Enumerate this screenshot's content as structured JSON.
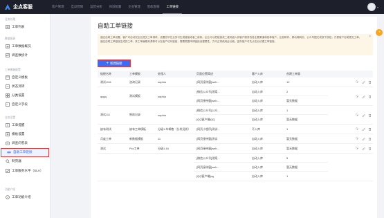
{
  "app": {
    "name": "企点客服"
  },
  "nav": [
    "客户管理",
    "互动营销",
    "运营分析",
    "体验配置",
    "企业管理",
    "智能客服",
    "工单链接"
  ],
  "sidebar": {
    "groups": [
      {
        "label": "业务处理",
        "items": [
          {
            "label": "工单列表",
            "icon": "list-icon"
          }
        ]
      },
      {
        "label": "数据报表",
        "items": [
          {
            "label": "工单数据概况",
            "icon": "chart-icon"
          },
          {
            "label": "调查数统计",
            "icon": "stats-icon"
          }
        ]
      },
      {
        "label": "工单模板配置",
        "items": [
          {
            "label": "自定义模板",
            "icon": "template-icon"
          },
          {
            "label": "状态流转",
            "icon": "flow-icon"
          },
          {
            "label": "分类设置",
            "icon": "category-icon"
          },
          {
            "label": "自定义字段",
            "icon": "field-icon"
          }
        ]
      },
      {
        "label": "业务设置",
        "items": [
          {
            "label": "工单提醒",
            "icon": "bell-icon"
          },
          {
            "label": "模板设置",
            "icon": "settings-icon"
          },
          {
            "label": "调查问卷表",
            "icon": "survey-icon"
          },
          {
            "label": "自助工单链接",
            "icon": "link-icon",
            "active": true
          },
          {
            "label": "制页器",
            "icon": "search-icon"
          },
          {
            "label": "工单服务水平（SLA）",
            "icon": "sla-icon"
          }
        ]
      },
      {
        "label": "功能介绍",
        "items": [
          {
            "label": "工单功能介绍",
            "icon": "info-icon"
          }
        ]
      }
    ]
  },
  "page": {
    "title": "自助工单链接",
    "notice": "通过自助工单设置，客户可自动完企业提交工单请求，设置完毕在业务可生成链接或者二维码。企业可以把链接或二维码嵌入到客户服务的各主要渠道和各种客户。比如邮件、移动端网页、公众号图文或按下按钮，方便客户自助提交工单。通过自助工单链接生成的工单，其工单编辑来源等可以在客户访问链接，需要根据申请链接创建属性，方可正常使用此功能。因存客户可先点击后访建工单链接。",
    "new_button": "新建链接"
  },
  "table": {
    "headers": [
      "链接名称",
      "工单模板",
      "处理人",
      "页面位置简述",
      "客户入库",
      "创建工单量"
    ],
    "rows": [
      {
        "name": "测试1111",
        "type": "咨询记录",
        "handler": "sophia",
        "subs": [
          {
            "page": "[网页接待窗]web...",
            "cust": "自动入库",
            "count": "12"
          }
        ],
        "ops": true
      },
      {
        "name": "qqqq",
        "type": "测试模板",
        "handler": "sophia",
        "subs": [
          {
            "page": "[微信公众号]测案...",
            "cust": "自动入库",
            "count": "2"
          },
          {
            "page": "[网页接待窗]web...",
            "cust": "自动入库",
            "count": "暂无数据"
          }
        ],
        "ops": true
      },
      {
        "name": "测试111",
        "type": "售前记录",
        "handler": "sophia",
        "subs": [
          {
            "page": "[微信公众号]公众...",
            "cust": "自动入库",
            "count": "1"
          },
          {
            "page": "[QQ客户端]QQ",
            "cust": "自动入库",
            "count": "暂无数据"
          }
        ],
        "ops": true
      },
      {
        "name": "缺有测试",
        "type": "缺有工单模板",
        "handler": "分级1-车辆售（分发员质）",
        "subs": [
          {
            "page": "[网页小程序]测试...",
            "cust": "不入库",
            "count": "1"
          }
        ],
        "ops": true
      },
      {
        "name": "月度工单",
        "type": "新数据模板",
        "handler": "11",
        "subs": [
          {
            "page": "[网页接待窗]测试",
            "cust": "自动入库",
            "count": "暂无数据"
          }
        ],
        "ops": true
      },
      {
        "name": "测试",
        "type": "Pcc工单",
        "handler": "分级1-16",
        "subs": [
          {
            "page": "[网页接待窗]web...",
            "cust": "自动入库",
            "count": "暂无数据"
          }
        ],
        "ops": true
      },
      {
        "name": "",
        "type": "",
        "handler": "",
        "subs": [
          {
            "page": "[微信公众号]测案...",
            "cust": "自动入库",
            "count": "5"
          },
          {
            "page": "[网页接待窗]web...",
            "cust": "自动入库",
            "count": "暂无数据"
          },
          {
            "page": "[QQ客户端]qq",
            "cust": "自动入库",
            "count": "1"
          }
        ],
        "ops": false
      }
    ]
  }
}
